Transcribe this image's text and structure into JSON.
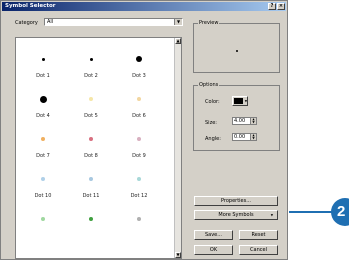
{
  "window": {
    "title": "Symbol Selector",
    "help_button": "?",
    "close_button": "×"
  },
  "category": {
    "label": "Category",
    "value": "All"
  },
  "symbols": [
    {
      "name": "Dot 1",
      "color": "#000000"
    },
    {
      "name": "Dot 2",
      "color": "#000000"
    },
    {
      "name": "Dot 3",
      "color": "#000000"
    },
    {
      "name": "Dot 4",
      "color": "#000000"
    },
    {
      "name": "Dot 5",
      "color": "#f5e6a8"
    },
    {
      "name": "Dot 6",
      "color": "#f2d6a0"
    },
    {
      "name": "Dot 7",
      "color": "#f0b060"
    },
    {
      "name": "Dot 8",
      "color": "#d87080"
    },
    {
      "name": "Dot 9",
      "color": "#d8b0c0"
    },
    {
      "name": "Dot 10",
      "color": "#b0d0e8"
    },
    {
      "name": "Dot 11",
      "color": "#a8c8e0"
    },
    {
      "name": "Dot 12",
      "color": "#a8d8d8"
    },
    {
      "name": "",
      "color": "#a0d8a0"
    },
    {
      "name": "",
      "color": "#40a040"
    },
    {
      "name": "",
      "color": "#b0b0b0"
    }
  ],
  "preview": {
    "title": "Preview"
  },
  "options": {
    "title": "Options",
    "color_label": "Color:",
    "color_value": "#000000",
    "size_label": "Size:",
    "size_value": "4.00",
    "angle_label": "Angle:",
    "angle_value": "0.00"
  },
  "buttons": {
    "properties": "Properties...",
    "more_symbols": "More Symbols",
    "save": "Save...",
    "reset": "Reset",
    "ok": "OK",
    "cancel": "Cancel"
  },
  "callout": {
    "number": "2"
  }
}
